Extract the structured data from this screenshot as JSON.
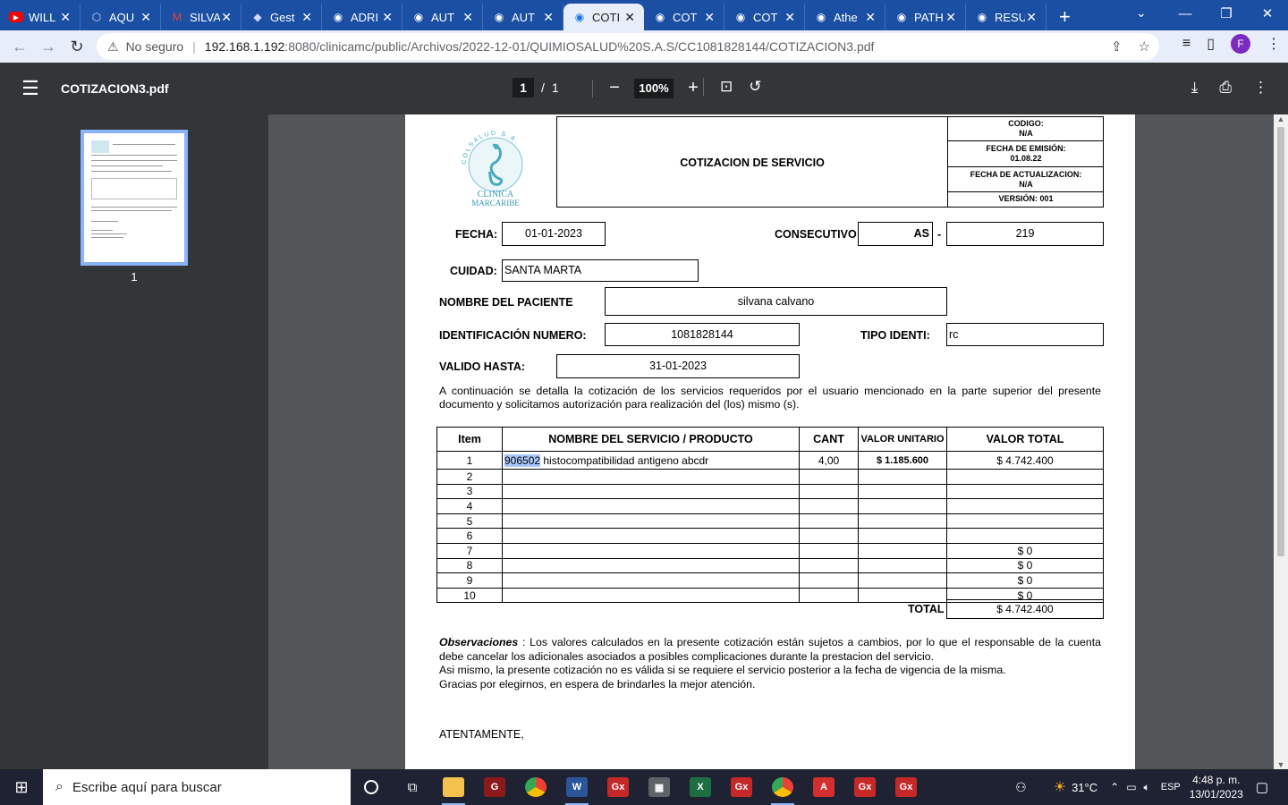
{
  "browser": {
    "tabs": [
      {
        "title": "WILL",
        "icon": "youtube-icon",
        "color": "#ff0000"
      },
      {
        "title": "AQU",
        "icon": "hexagon-icon",
        "color": "#cfd8ff"
      },
      {
        "title": "SILVA",
        "icon": "gmail-icon",
        "color": "#ea4335"
      },
      {
        "title": "Gest",
        "icon": "leaf-icon",
        "color": "#cfd8ff"
      },
      {
        "title": "ADRI",
        "icon": "globe-icon",
        "color": "#ffffff"
      },
      {
        "title": "AUT",
        "icon": "globe-icon",
        "color": "#ffffff"
      },
      {
        "title": "AUT",
        "icon": "globe-icon",
        "color": "#ffffff"
      },
      {
        "title": "COTI",
        "icon": "globe-icon",
        "color": "#1a73e8",
        "active": true
      },
      {
        "title": "COT",
        "icon": "globe-icon",
        "color": "#ffffff"
      },
      {
        "title": "COT",
        "icon": "globe-icon",
        "color": "#ffffff"
      },
      {
        "title": "Athe",
        "icon": "globe-icon",
        "color": "#ffffff"
      },
      {
        "title": "PATH",
        "icon": "globe-icon",
        "color": "#ffffff"
      },
      {
        "title": "RESU",
        "icon": "globe-icon",
        "color": "#ffffff"
      }
    ],
    "new_tab": "+",
    "security_label": "No seguro",
    "url_host": "192.168.1.192",
    "url_rest": ":8080/clinicamc/public/Archivos/2022-12-01/QUIMIOSALUD%20S.A.S/CC1081828144/COTIZACION3.pdf",
    "profile_initial": "F"
  },
  "pdf": {
    "filename": "COTIZACION3.pdf",
    "page_current": "1",
    "page_sep": "/",
    "page_total": "1",
    "zoom": "100%",
    "thumb_label": "1"
  },
  "doc": {
    "logo_text_1": "CLINICA",
    "logo_text_2": "MARCARIBE",
    "logo_arc": "COLSALUD S.A.",
    "title": "COTIZACION DE SERVICIO",
    "codigo_label": "CODIGO:",
    "codigo_value": "N/A",
    "emision_label": "FECHA DE EMISIÓN:",
    "emision_value": "01.08.22",
    "actualizacion_label": "FECHA DE ACTUALIZACION:",
    "actualizacion_value": "N/A",
    "version": "VERSIÓN: 001",
    "fecha_label": "FECHA:",
    "fecha_value": "01-01-2023",
    "consecutivo_label": "CONSECUTIVO",
    "consecutivo_prefix": "AS",
    "consecutivo_dash": "-",
    "consecutivo_value": "219",
    "ciudad_label": "CUIDAD:",
    "ciudad_value": "SANTA MARTA",
    "paciente_label": "NOMBRE DEL PACIENTE",
    "paciente_value": "silvana calvano",
    "id_label": "IDENTIFICACIÓN NUMERO:",
    "id_value": "1081828144",
    "tipo_label": "TIPO IDENTI:",
    "tipo_value": "rc",
    "valido_label": "VALIDO HASTA:",
    "valido_value": "31-01-2023",
    "intro": "A continuación se detalla la cotización de los servicios requeridos por el usuario mencionado en la parte superior del presente documento y solicitamos autorización para realización del (los) mismo (s).",
    "table_headers": [
      "Item",
      "NOMBRE DEL SERVICIO / PRODUCTO",
      "CANT",
      "VALOR UNITARIO",
      "VALOR TOTAL"
    ],
    "rows": [
      {
        "item": "1",
        "code": "906502",
        "name": " histocompatibilidad antigeno abcdr",
        "cant": "4,00",
        "unit": "$ 1.185.600",
        "total": "$ 4.742.400"
      },
      {
        "item": "2",
        "code": "",
        "name": "",
        "cant": "",
        "unit": "",
        "total": ""
      },
      {
        "item": "3",
        "code": "",
        "name": "",
        "cant": "",
        "unit": "",
        "total": ""
      },
      {
        "item": "4",
        "code": "",
        "name": "",
        "cant": "",
        "unit": "",
        "total": ""
      },
      {
        "item": "5",
        "code": "",
        "name": "",
        "cant": "",
        "unit": "",
        "total": ""
      },
      {
        "item": "6",
        "code": "",
        "name": "",
        "cant": "",
        "unit": "",
        "total": ""
      },
      {
        "item": "7",
        "code": "",
        "name": "",
        "cant": "",
        "unit": "",
        "total": "$ 0"
      },
      {
        "item": "8",
        "code": "",
        "name": "",
        "cant": "",
        "unit": "",
        "total": "$ 0"
      },
      {
        "item": "9",
        "code": "",
        "name": "",
        "cant": "",
        "unit": "",
        "total": "$ 0"
      },
      {
        "item": "10",
        "code": "",
        "name": "",
        "cant": "",
        "unit": "",
        "total": "$ 0"
      }
    ],
    "total_label": "TOTAL",
    "total_value": "$ 4.742.400",
    "obs_label": "Observaciones",
    "obs_text_1": " : Los valores calculados en la presente cotización están sujetos a cambios, por lo que el responsable de la cuenta debe cancelar los adicionales asociados a posibles complicaciones durante la prestacion del servicio.",
    "obs_text_2": "Asi mismo, la presente cotización no es válida si se requiere el servicio posterior a la fecha de vigencia de la misma.",
    "obs_text_3": "Gracias por elegirnos, en espera de brindarles la mejor atención.",
    "closing": "ATENTAMENTE,"
  },
  "taskbar": {
    "search_placeholder": "Escribe aquí para buscar",
    "weather": "31°C",
    "lang": "ESP",
    "time": "4:48 p. m.",
    "date": "13/01/2023",
    "apps": [
      {
        "name": "file-explorer-icon",
        "color": "#f4c04e",
        "glyph": ""
      },
      {
        "name": "app-gx-icon",
        "color": "#8b1a1a",
        "glyph": "G"
      },
      {
        "name": "chrome-icon",
        "color": "#34a853",
        "glyph": ""
      },
      {
        "name": "word-icon",
        "color": "#2b579a",
        "glyph": "W"
      },
      {
        "name": "app-gx-icon",
        "color": "#c62828",
        "glyph": "Gx"
      },
      {
        "name": "calculator-icon",
        "color": "#5f6368",
        "glyph": "▦"
      },
      {
        "name": "excel-icon",
        "color": "#1d6f42",
        "glyph": "X"
      },
      {
        "name": "app-gx-icon",
        "color": "#c62828",
        "glyph": "Gx"
      },
      {
        "name": "chrome-profile-icon",
        "color": "#34a853",
        "glyph": ""
      },
      {
        "name": "acrobat-icon",
        "color": "#d32f2f",
        "glyph": "A"
      },
      {
        "name": "app-gx-icon",
        "color": "#c62828",
        "glyph": "Gx"
      },
      {
        "name": "app-gx-icon",
        "color": "#c62828",
        "glyph": "Gx"
      }
    ]
  }
}
